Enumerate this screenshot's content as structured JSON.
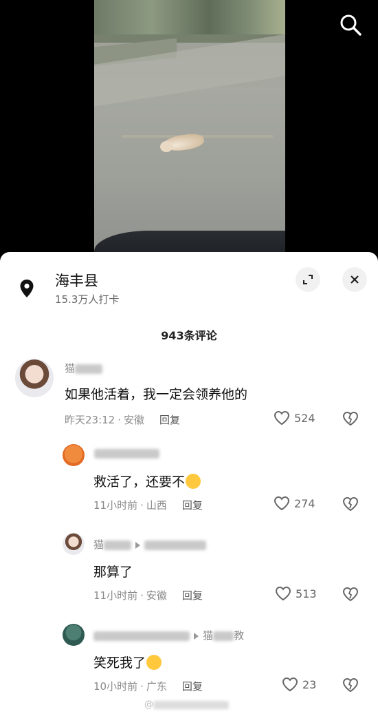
{
  "location": {
    "title": "海丰县",
    "subtitle": "15.3万人打卡"
  },
  "comment_count": "943条评论",
  "comments": [
    {
      "name_visible": "猫",
      "text": "如果他活着，我一定会领养他的",
      "time": "昨天23:12",
      "region": "安徽",
      "reply": "回复",
      "likes": "524"
    },
    {
      "name_visible": "",
      "text": "救活了，还要不",
      "time": "11小时前",
      "region": "山西",
      "reply": "回复",
      "likes": "274"
    },
    {
      "name_visible": "猫",
      "text": "那算了",
      "time": "11小时前",
      "region": "安徽",
      "reply": "回复",
      "likes": "513"
    },
    {
      "name_visible": "猫",
      "name_suffix": "教",
      "text": "笑死我了",
      "time": "10小时前",
      "region": "广东",
      "reply": "回复",
      "likes": "23"
    }
  ],
  "watermark": "@",
  "colors": {
    "sheet": "#ffffff",
    "muted": "#8a8a8a",
    "emoji": "#ffc83d"
  }
}
